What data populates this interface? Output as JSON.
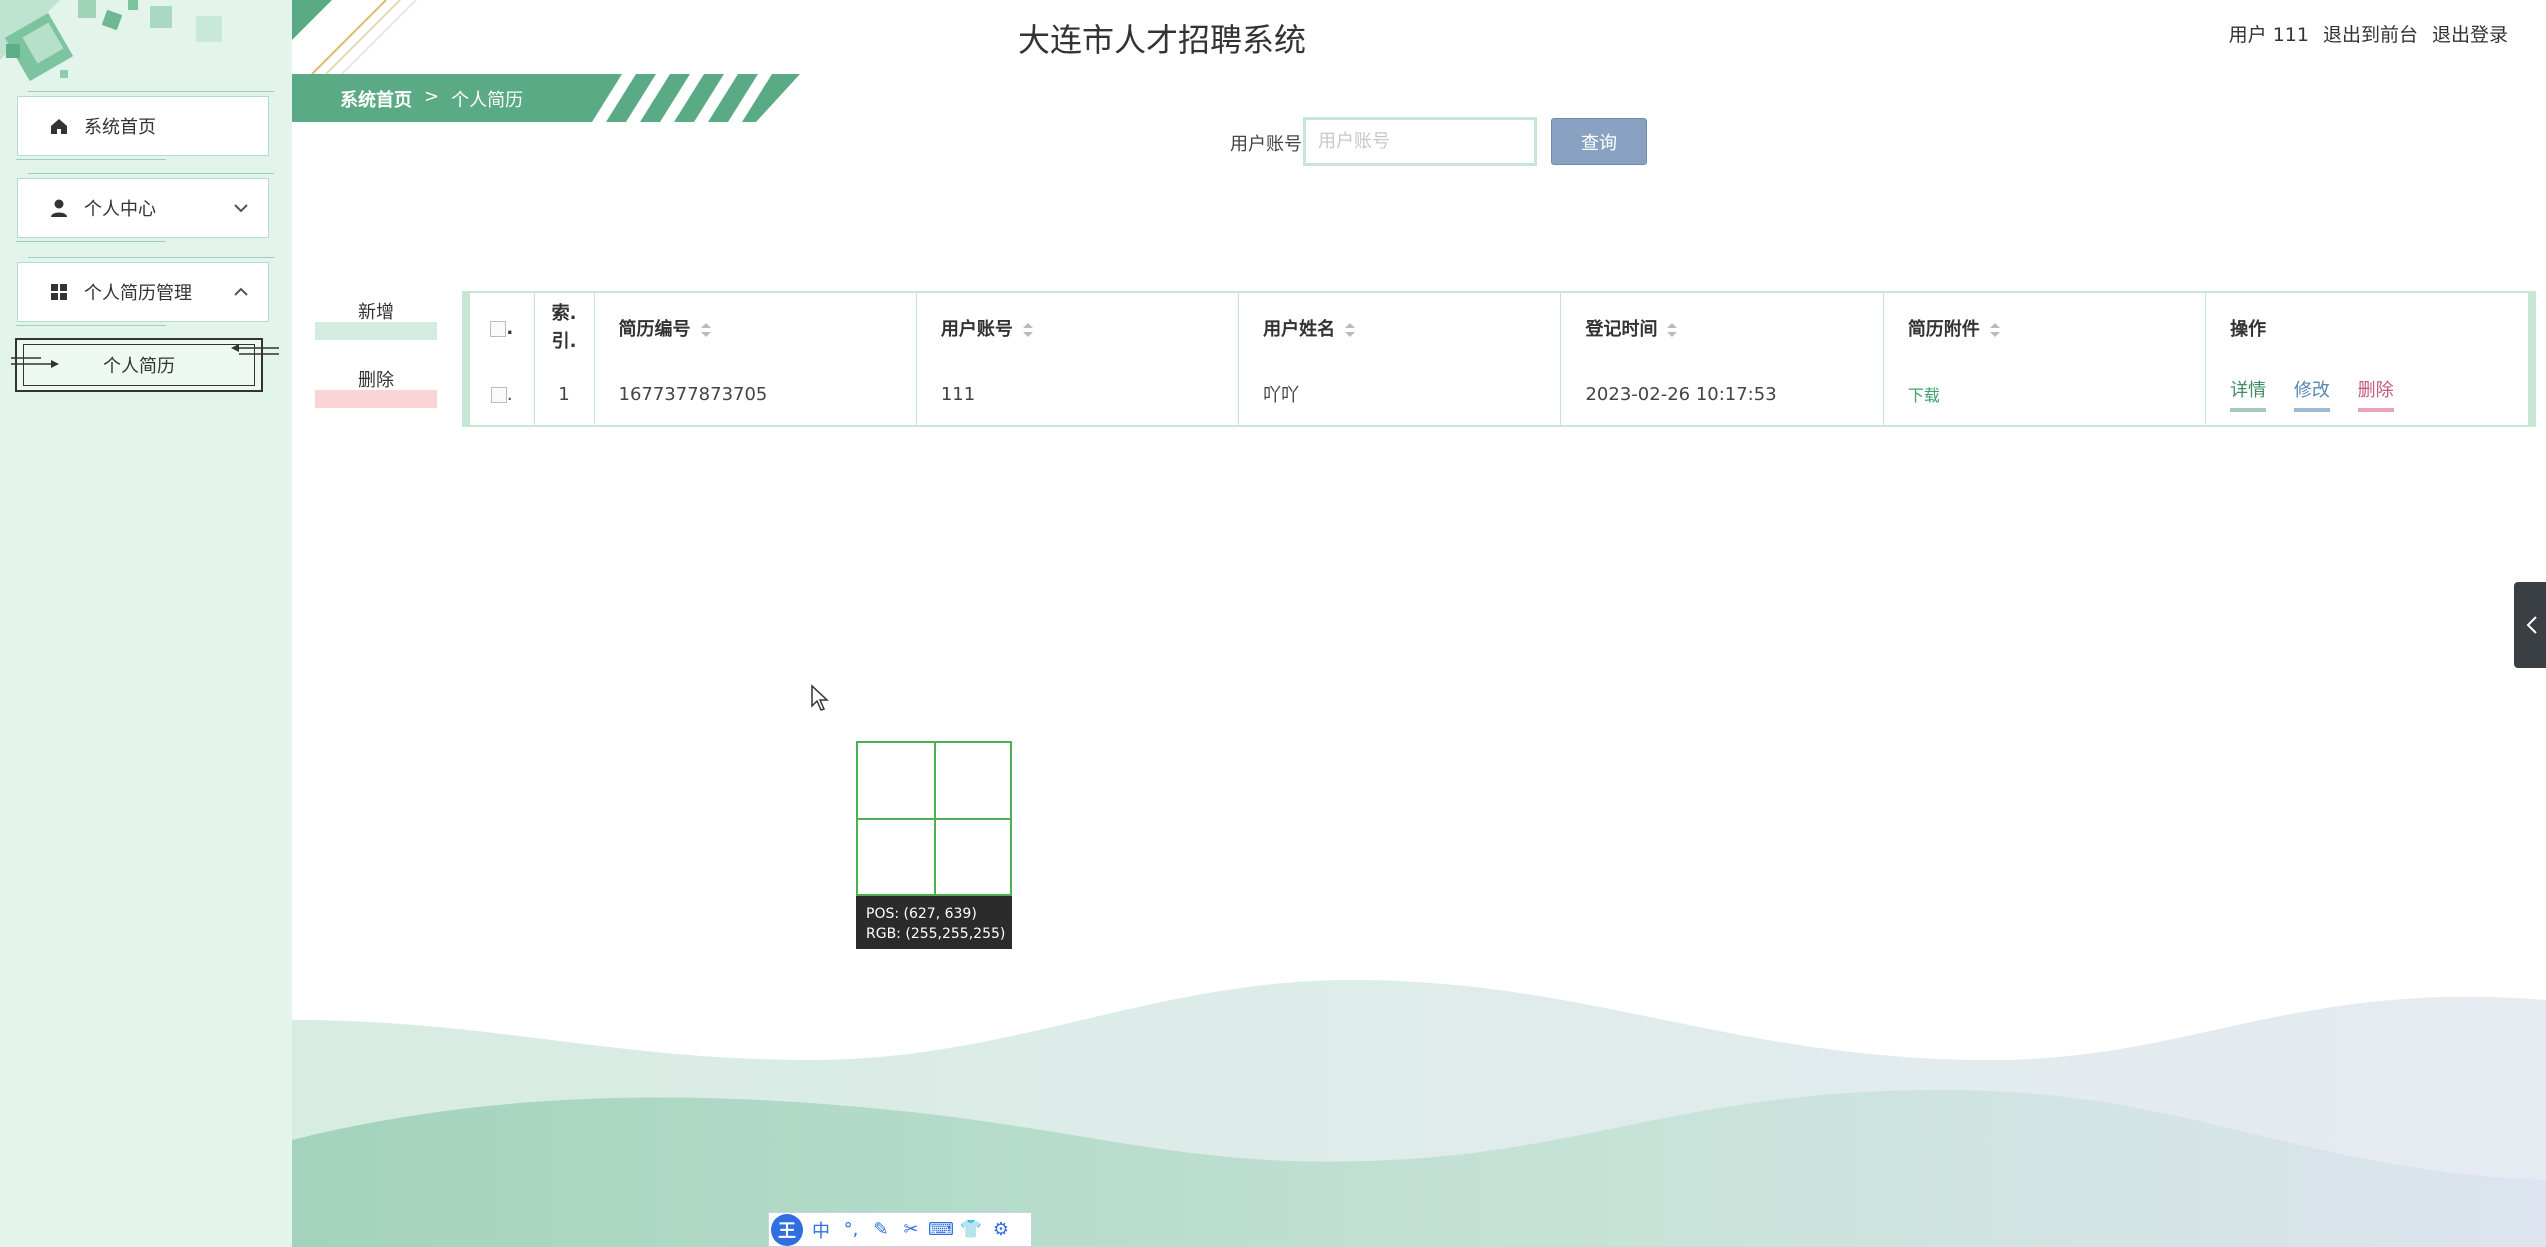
{
  "header": {
    "title": "大连市人才招聘系统",
    "user_label": "用户 111",
    "back_to_front": "退出到前台",
    "logout": "退出登录"
  },
  "sidebar": {
    "items": [
      {
        "label": "系统首页",
        "icon": "home-icon"
      },
      {
        "label": "个人中心",
        "icon": "user-icon"
      },
      {
        "label": "个人简历管理",
        "icon": "grid-icon"
      }
    ],
    "submenu": {
      "label": "个人简历"
    }
  },
  "breadcrumb": {
    "home": "系统首页",
    "separator": ">",
    "current": "个人简历"
  },
  "search": {
    "label": "用户账号",
    "placeholder": "用户账号",
    "value": "",
    "button": "查询"
  },
  "actions": {
    "add": "新增",
    "delete": "删除"
  },
  "table": {
    "headers": [
      "索.引.",
      "简历编号",
      "用户账号",
      "用户姓名",
      "登记时间",
      "简历附件",
      "操作"
    ],
    "index_header_line1": "索.",
    "index_header_line2": "引.",
    "rows": [
      {
        "index": "1",
        "resume_no": "1677377873705",
        "account": "111",
        "name": "吖吖",
        "time": "2023-02-26 10:17:53",
        "attachment": "下载",
        "ops": {
          "detail": "详情",
          "edit": "修改",
          "delete": "删除"
        }
      }
    ]
  },
  "picker": {
    "pos_label": "POS:",
    "pos": "(627, 639)",
    "rgb_label": "RGB:",
    "rgb": "(255,255,255)"
  },
  "ime": {
    "logo": "王",
    "items": [
      "中",
      "°,",
      "✎",
      "✂",
      "⌨",
      "👕",
      "⚙"
    ]
  },
  "colors": {
    "accent": "#5aaa85",
    "sidebar_bg": "#e3f4ec",
    "table_border": "#c7e6d6",
    "search_button": "#8aa2c2",
    "add_bar": "#d4ebe0",
    "delete_bar": "#fbd5d5"
  }
}
